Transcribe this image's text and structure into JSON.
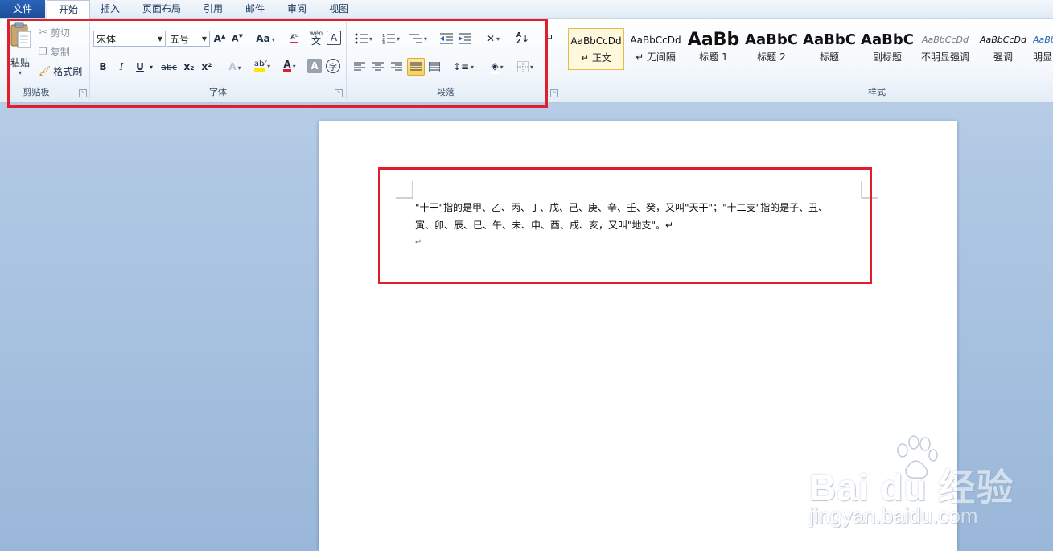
{
  "menu": {
    "tabs": [
      "文件",
      "开始",
      "插入",
      "页面布局",
      "引用",
      "邮件",
      "审阅",
      "视图"
    ]
  },
  "clipboard": {
    "paste": "粘贴",
    "cut": "剪切",
    "copy": "复制",
    "format_painter": "格式刷",
    "label": "剪贴板"
  },
  "font": {
    "name": "宋体",
    "size": "五号",
    "label": "字体",
    "buttons": [
      "B",
      "I",
      "U",
      "abc",
      "x₂",
      "x²"
    ]
  },
  "paragraph": {
    "label": "段落"
  },
  "styles": {
    "label": "样式",
    "items": [
      {
        "sample": "AaBbCcDd",
        "name": "↵ 正文"
      },
      {
        "sample": "AaBbCcDd",
        "name": "↵ 无间隔"
      },
      {
        "sample": "AaBb",
        "name": "标题 1"
      },
      {
        "sample": "AaBbC",
        "name": "标题 2"
      },
      {
        "sample": "AaBbC",
        "name": "标题"
      },
      {
        "sample": "AaBbC",
        "name": "副标题"
      },
      {
        "sample": "AaBbCcDd",
        "name": "不明显强调"
      },
      {
        "sample": "AaBbCcDd",
        "name": "强调"
      },
      {
        "sample": "AaBb",
        "name": "明显"
      }
    ]
  },
  "document": {
    "line1": "\"十干\"指的是甲、乙、丙、丁、戊、己、庚、辛、壬、癸，又叫\"天干\"；\"十二支\"指的是子、丑、",
    "line2": "寅、卯、辰、巳、午、未、申、酉、戌、亥，又叫\"地支\"。↵",
    "line3": "↵"
  },
  "watermark": {
    "logo": "Bai du 经验",
    "url": "jingyan.baidu.com"
  },
  "colors": {
    "highlight_box": "#e01e2c",
    "file_tab": "#2a63b8",
    "font_color": "#e01e2c",
    "highlight_color": "#ffe600"
  }
}
